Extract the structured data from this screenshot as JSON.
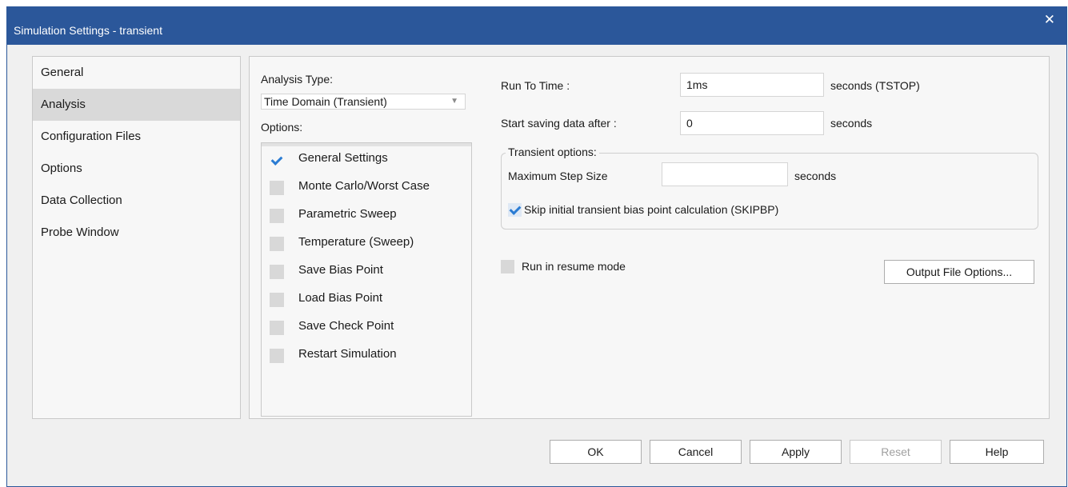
{
  "window": {
    "title": "Simulation Settings - transient"
  },
  "nav": {
    "items": [
      {
        "label": "General"
      },
      {
        "label": "Analysis"
      },
      {
        "label": "Configuration Files"
      },
      {
        "label": "Options"
      },
      {
        "label": "Data Collection"
      },
      {
        "label": "Probe Window"
      }
    ],
    "selected": "Analysis"
  },
  "analysis": {
    "type_label": "Analysis Type:",
    "type_value": "Time Domain (Transient)",
    "options_label": "Options:",
    "options": [
      {
        "label": "General Settings",
        "checked": true
      },
      {
        "label": "Monte Carlo/Worst Case",
        "checked": false
      },
      {
        "label": "Parametric Sweep",
        "checked": false
      },
      {
        "label": "Temperature (Sweep)",
        "checked": false
      },
      {
        "label": "Save Bias Point",
        "checked": false
      },
      {
        "label": "Load Bias Point",
        "checked": false
      },
      {
        "label": "Save Check Point",
        "checked": false
      },
      {
        "label": "Restart Simulation",
        "checked": false
      }
    ]
  },
  "transient": {
    "run_to_time_label": "Run To Time :",
    "run_to_time_value": "1ms",
    "run_to_time_unit": "seconds (TSTOP)",
    "start_saving_label": "Start saving data after :",
    "start_saving_value": "0",
    "start_saving_unit": "seconds",
    "group_title": "Transient options:",
    "max_step_label": "Maximum Step Size",
    "max_step_value": "",
    "max_step_unit": "seconds",
    "skip_bias_label": "Skip initial transient bias point calculation (SKIPBP)",
    "skip_bias_checked": true,
    "resume_label": "Run in resume mode",
    "resume_checked": false,
    "output_file_options": "Output File Options..."
  },
  "buttons": {
    "ok": "OK",
    "cancel": "Cancel",
    "apply": "Apply",
    "reset": "Reset",
    "help": "Help"
  },
  "icons": {
    "close": "close-icon",
    "dropdown": "chevron-down-icon",
    "check": "check-icon"
  }
}
